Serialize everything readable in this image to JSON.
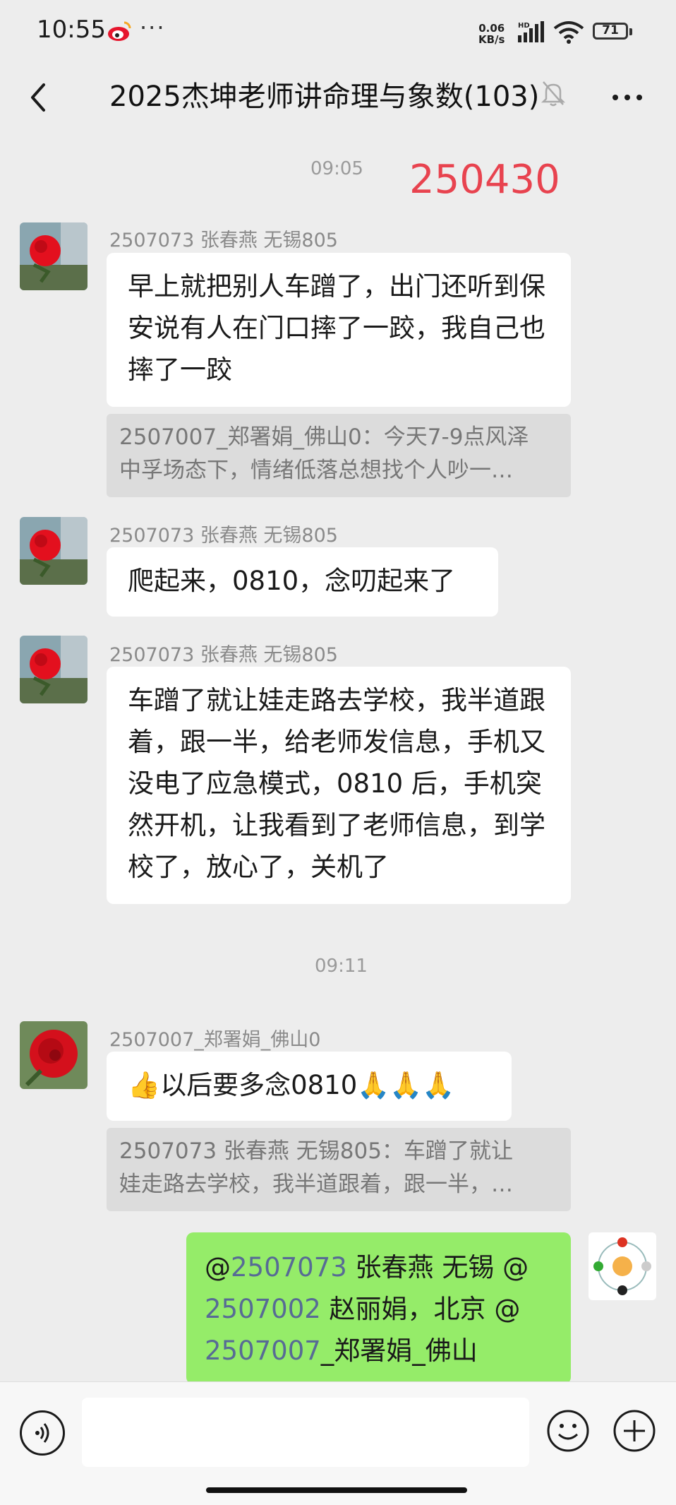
{
  "status_bar": {
    "time": "10:55",
    "more_icon": "···",
    "net_speed_value": "0.06",
    "net_speed_unit": "KB/s",
    "network": "HD",
    "battery": "71"
  },
  "header": {
    "title": "2025杰坤老师讲命理与象数(103)"
  },
  "messages": {
    "time1": "09:05",
    "stamp": "250430",
    "m1": {
      "sender": "2507073 张春燕  无锡805",
      "text": "早上就把别人车蹭了，出门还听到保安说有人在门口摔了一跤，我自己也摔了一跤",
      "quote_line1": "2507007_郑署娟_佛山0：今天7-9点风泽",
      "quote_line2": "中孚场态下，情绪低落总想找个人吵一…"
    },
    "m2": {
      "sender": "2507073 张春燕  无锡805",
      "text": "爬起来，0810，念叨起来了"
    },
    "m3": {
      "sender": "2507073 张春燕  无锡805",
      "text": "车蹭了就让娃走路去学校，我半道跟着，跟一半，给老师发信息，手机又没电了应急模式，0810 后，手机突然开机，让我看到了老师信息，到学校了，放心了，关机了"
    },
    "time2": "09:11",
    "m4": {
      "sender": "2507007_郑署娟_佛山0",
      "text": "👍以后要多念0810🙏🙏🙏",
      "quote_line1": "2507073 张春燕  无锡805：车蹭了就让",
      "quote_line2": "娃走路去学校，我半道跟着，跟一半，…"
    },
    "own": {
      "at1": "@",
      "id1": "2507073",
      "rest1": " 张春燕  无锡  @",
      "id2": "2507002",
      "rest2": " 赵丽娟，北京  @",
      "id3": "2507007",
      "rest3": "_郑署娟_佛山"
    }
  },
  "colors": {
    "accent_green": "#95ec69",
    "stamp_red": "#e8434f",
    "link_blue": "#576b95"
  },
  "icons": [
    "weibo-icon",
    "signal-icon",
    "wifi-icon",
    "back-icon",
    "mute-icon",
    "more-icon",
    "voice-icon",
    "emoji-icon",
    "plus-icon"
  ]
}
